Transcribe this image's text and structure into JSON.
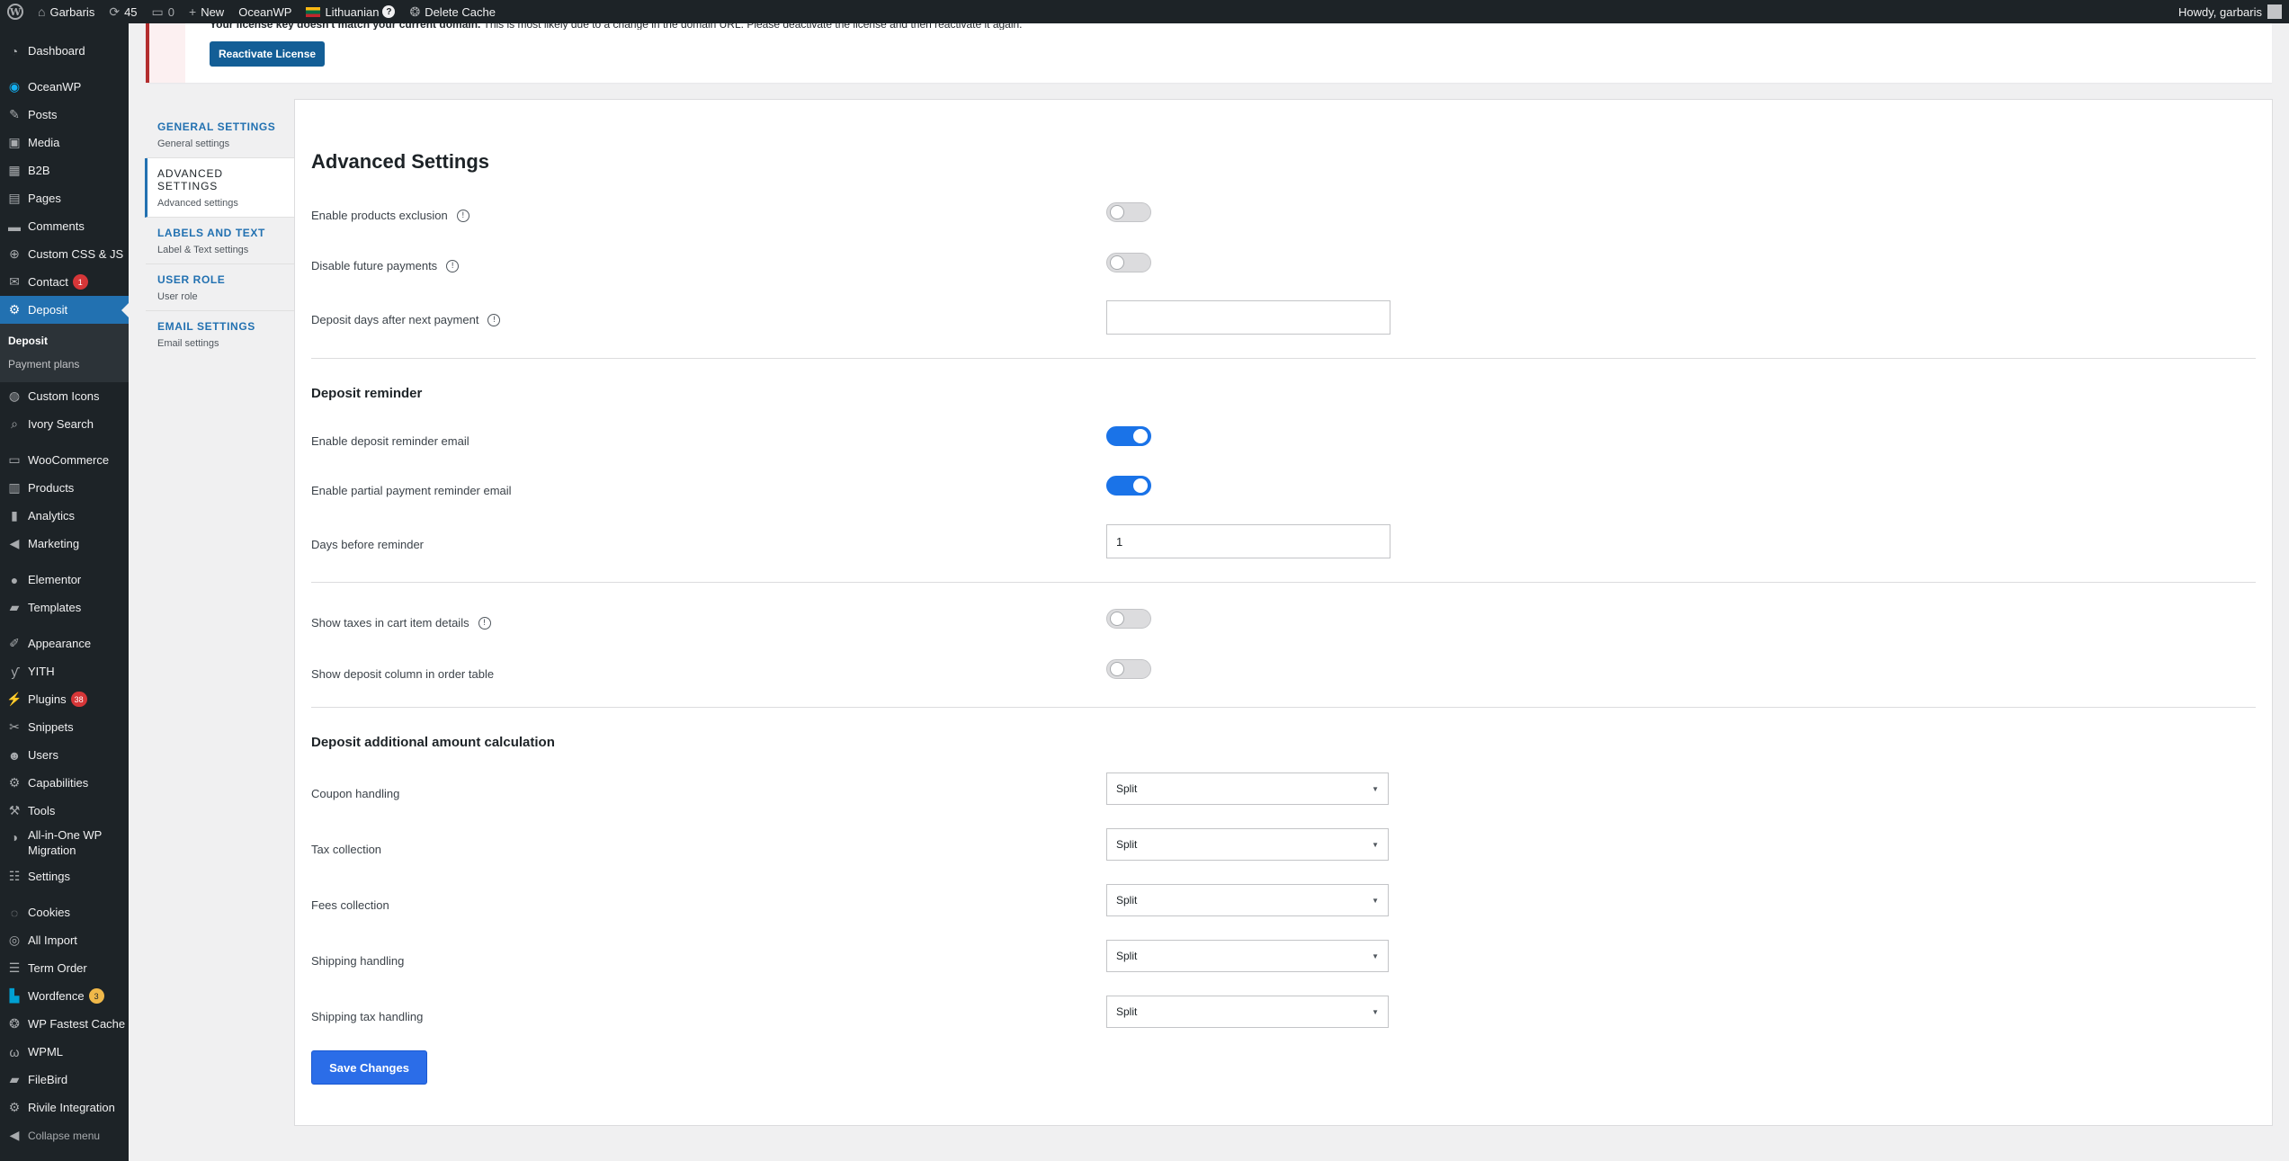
{
  "admin_bar": {
    "site_name": "Garbaris",
    "updates_count": "45",
    "comments_count": "0",
    "new_label": "New",
    "theme_label": "OceanWP",
    "language_label": "Lithuanian",
    "language_badge": "?",
    "cache_label": "Delete Cache",
    "greeting": "Howdy, garbaris"
  },
  "sidebar": {
    "items": [
      {
        "label": "Dashboard",
        "icon": "dashboard-icon"
      },
      {
        "label": "OceanWP",
        "icon": "oceanwp-icon"
      },
      {
        "label": "Posts",
        "icon": "pin-icon"
      },
      {
        "label": "Media",
        "icon": "media-icon"
      },
      {
        "label": "B2B",
        "icon": "grid-icon"
      },
      {
        "label": "Pages",
        "icon": "page-icon"
      },
      {
        "label": "Comments",
        "icon": "comment-icon"
      },
      {
        "label": "Custom CSS & JS",
        "icon": "plus-circle-icon"
      },
      {
        "label": "Contact",
        "icon": "mail-icon",
        "badge": "1"
      },
      {
        "label": "Deposit",
        "icon": "gear-icon"
      },
      {
        "label": "Custom Icons",
        "icon": "globe-icon"
      },
      {
        "label": "Ivory Search",
        "icon": "search-icon"
      },
      {
        "label": "WooCommerce",
        "icon": "woocommerce-icon"
      },
      {
        "label": "Products",
        "icon": "box-icon"
      },
      {
        "label": "Analytics",
        "icon": "bar-chart-icon"
      },
      {
        "label": "Marketing",
        "icon": "megaphone-icon"
      },
      {
        "label": "Elementor",
        "icon": "elementor-icon"
      },
      {
        "label": "Templates",
        "icon": "folder-icon"
      },
      {
        "label": "Appearance",
        "icon": "brush-icon"
      },
      {
        "label": "YITH",
        "icon": "yith-icon"
      },
      {
        "label": "Plugins",
        "icon": "plug-icon",
        "badge": "38"
      },
      {
        "label": "Snippets",
        "icon": "scissors-icon"
      },
      {
        "label": "Users",
        "icon": "user-icon"
      },
      {
        "label": "Capabilities",
        "icon": "gear-icon"
      },
      {
        "label": "Tools",
        "icon": "wrench-icon"
      },
      {
        "label": "All-in-One WP Migration",
        "icon": "migration-icon"
      },
      {
        "label": "Settings",
        "icon": "sliders-icon"
      },
      {
        "label": "Cookies",
        "icon": "cookie-icon"
      },
      {
        "label": "All Import",
        "icon": "import-icon"
      },
      {
        "label": "Term Order",
        "icon": "list-icon"
      },
      {
        "label": "Wordfence",
        "icon": "wordfence-icon",
        "badge": "3"
      },
      {
        "label": "WP Fastest Cache",
        "icon": "cheetah-icon"
      },
      {
        "label": "WPML",
        "icon": "wpml-icon"
      },
      {
        "label": "FileBird",
        "icon": "folder-icon"
      },
      {
        "label": "Rivile Integration",
        "icon": "gear-icon"
      }
    ],
    "submenu": [
      "Deposit",
      "Payment plans"
    ],
    "collapse_label": "Collapse menu"
  },
  "notice": {
    "text_bold": "Your license key doesn't match your current domain.",
    "text": " This is most likely due to a change in the domain URL. Please deactivate the license and then reactivate it again.",
    "button_label": "Reactivate License"
  },
  "tabs": [
    {
      "title": "GENERAL SETTINGS",
      "subtitle": "General settings"
    },
    {
      "title": "ADVANCED SETTINGS",
      "subtitle": "Advanced settings"
    },
    {
      "title": "LABELS AND TEXT",
      "subtitle": "Label & Text settings"
    },
    {
      "title": "USER ROLE",
      "subtitle": "User role"
    },
    {
      "title": "EMAIL SETTINGS",
      "subtitle": "Email settings"
    }
  ],
  "panel": {
    "title": "Advanced Settings",
    "help_glyph": "!",
    "fields": {
      "enable_products_exclusion": {
        "label": "Enable products exclusion",
        "value": false
      },
      "disable_future_payments": {
        "label": "Disable future payments",
        "value": false
      },
      "deposit_days_after_next_payment": {
        "label": "Deposit days after next payment",
        "value": ""
      },
      "enable_deposit_reminder_email": {
        "label": "Enable deposit reminder email",
        "value": true
      },
      "enable_partial_payment_reminder_email": {
        "label": "Enable partial payment reminder email",
        "value": true
      },
      "days_before_reminder": {
        "label": "Days before reminder",
        "value": "1"
      },
      "show_taxes_in_cart_item_details": {
        "label": "Show taxes in cart item details",
        "value": false
      },
      "show_deposit_column_in_order_table": {
        "label": "Show deposit column in order table",
        "value": false
      },
      "coupon_handling": {
        "label": "Coupon handling",
        "value": "Split"
      },
      "tax_collection": {
        "label": "Tax collection",
        "value": "Split"
      },
      "fees_collection": {
        "label": "Fees collection",
        "value": "Split"
      },
      "shipping_handling": {
        "label": "Shipping handling",
        "value": "Split"
      },
      "shipping_tax_handling": {
        "label": "Shipping tax handling",
        "value": "Split"
      }
    },
    "section_reminder": "Deposit reminder",
    "section_additional": "Deposit additional amount calculation",
    "save_label": "Save Changes"
  }
}
